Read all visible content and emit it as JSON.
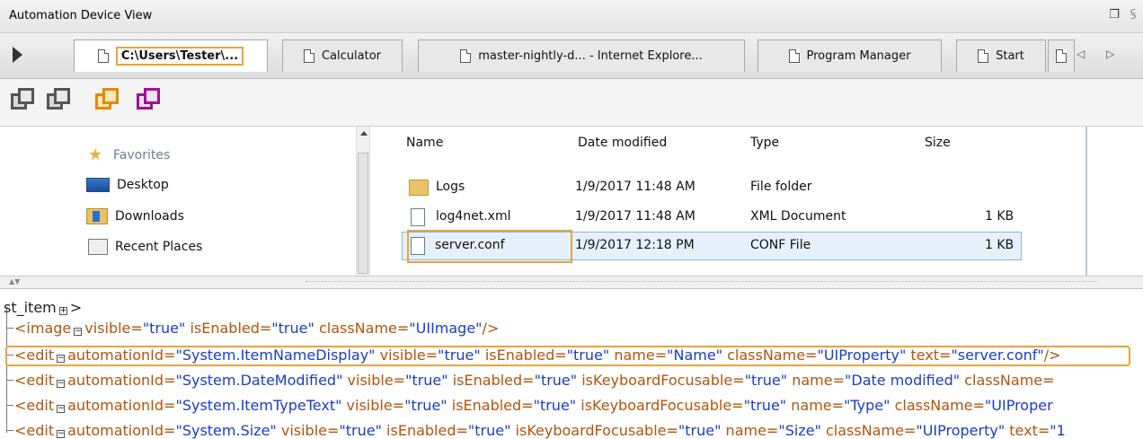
{
  "window": {
    "title": "Automation Device View",
    "restore_glyph": "❐",
    "pin_glyph": "⫓"
  },
  "tabs": [
    {
      "label": "C:\\Users\\Tester\\..."
    },
    {
      "label": "Calculator"
    },
    {
      "label": "master-nightly-d... - Internet Explore..."
    },
    {
      "label": "Program Manager"
    },
    {
      "label": "Start"
    }
  ],
  "tab_nav": "◁ ▷",
  "toolbar": {
    "icons": [
      "capture-gray-icon",
      "capture-gray-2-icon",
      "highlight-orange-icon",
      "inspect-purple-icon"
    ]
  },
  "explorer": {
    "nav": [
      {
        "label": "Favorites",
        "icon": "star-icon"
      },
      {
        "label": "Desktop",
        "icon": "desktop-icon"
      },
      {
        "label": "Downloads",
        "icon": "downloads-icon"
      },
      {
        "label": "Recent Places",
        "icon": "recent-places-icon"
      }
    ],
    "columns": [
      "Name",
      "Date modified",
      "Type",
      "Size"
    ],
    "rows": [
      {
        "name": "Logs",
        "date": "1/9/2017 11:48 AM",
        "type": "File folder",
        "size": "",
        "icon": "folder-icon"
      },
      {
        "name": "log4net.xml",
        "date": "1/9/2017 11:48 AM",
        "type": "XML Document",
        "size": "1 KB",
        "icon": "xml-file-icon"
      },
      {
        "name": "server.conf",
        "date": "1/9/2017 12:18 PM",
        "type": "CONF File",
        "size": "1 KB",
        "icon": "conf-file-icon"
      }
    ]
  },
  "tree": {
    "root": "st_item",
    "root_tail": ">",
    "lines": [
      {
        "tag": "<image",
        "attrs": [
          [
            "visible",
            "true"
          ],
          [
            "isEnabled",
            "true"
          ],
          [
            "className",
            "UIImage"
          ]
        ],
        "close": "/>"
      },
      {
        "tag": "<edit",
        "attrs": [
          [
            "automationId",
            "System.ItemNameDisplay"
          ],
          [
            "visible",
            "true"
          ],
          [
            "isEnabled",
            "true"
          ],
          [
            "name",
            "Name"
          ],
          [
            "className",
            "UIProperty"
          ],
          [
            "text",
            "server.conf"
          ]
        ],
        "close": "/>"
      },
      {
        "tag": "<edit",
        "attrs": [
          [
            "automationId",
            "System.DateModified"
          ],
          [
            "visible",
            "true"
          ],
          [
            "isEnabled",
            "true"
          ],
          [
            "isKeyboardFocusable",
            "true"
          ],
          [
            "name",
            "Date modified"
          ],
          [
            "className",
            ""
          ]
        ],
        "close": ""
      },
      {
        "tag": "<edit",
        "attrs": [
          [
            "automationId",
            "System.ItemTypeText"
          ],
          [
            "visible",
            "true"
          ],
          [
            "isEnabled",
            "true"
          ],
          [
            "isKeyboardFocusable",
            "true"
          ],
          [
            "name",
            "Type"
          ],
          [
            "className",
            "UIProper"
          ]
        ],
        "close": ""
      },
      {
        "tag": "<edit",
        "attrs": [
          [
            "automationId",
            "System.Size"
          ],
          [
            "visible",
            "true"
          ],
          [
            "isEnabled",
            "true"
          ],
          [
            "isKeyboardFocusable",
            "true"
          ],
          [
            "name",
            "Size"
          ],
          [
            "className",
            "UIProperty"
          ],
          [
            "text",
            "1"
          ]
        ],
        "close": ""
      }
    ]
  }
}
